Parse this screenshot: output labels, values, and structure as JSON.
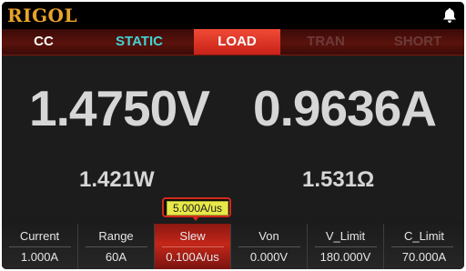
{
  "header": {
    "brand": "RIGOL",
    "bell_icon": "bell-icon"
  },
  "tabs": {
    "mode": "CC",
    "static": "STATIC",
    "load": "LOAD",
    "tran": "TRAN",
    "short": "SHORT"
  },
  "readout": {
    "voltage": "1.4750V",
    "current": "0.9636A",
    "power": "1.421W",
    "resistance": "1.531Ω"
  },
  "popup": {
    "value": "5.000A/us"
  },
  "softkeys": [
    {
      "label": "Current",
      "value": "1.000A"
    },
    {
      "label": "Range",
      "value": "60A"
    },
    {
      "label": "Slew",
      "value": "0.100A/us"
    },
    {
      "label": "Von",
      "value": "0.000V"
    },
    {
      "label": "V_Limit",
      "value": "180.000V"
    },
    {
      "label": "C_Limit",
      "value": "70.000A"
    }
  ],
  "colors": {
    "brand": "#e8a32a",
    "static_tab": "#40d4d4",
    "active_tab": "#e03a2a",
    "inactive_tab": "#6a3b38",
    "readout": "#d6d6d6",
    "popup_fill": "#e8e84a"
  }
}
